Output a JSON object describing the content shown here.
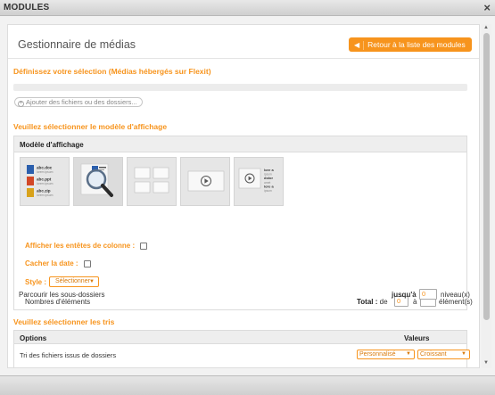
{
  "window": {
    "title": "MODULES",
    "close_glyph": "×"
  },
  "header": {
    "title": "Gestionnaire de médias",
    "back_button": "Retour à la liste des modules"
  },
  "selection": {
    "title": "Définissez votre sélection (Médias hébergés sur Flexit)",
    "add_button": "Ajouter des fichiers ou des dossiers..."
  },
  "display": {
    "title": "Veuillez sélectionner le modèle d'affichage",
    "panel_title": "Modèle d'affichage",
    "list_items": [
      {
        "name": "abc.doc",
        "sub": "lorem ipsum"
      },
      {
        "name": "abc.ppt",
        "sub": "lorem ipsum"
      },
      {
        "name": "abc.zip",
        "sub": "lorem ipsum"
      }
    ],
    "list_item_colors": [
      "#2b5fad",
      "#d24726",
      "#d8a21b"
    ],
    "side_text": [
      "lore a",
      "ipsum",
      "dolor",
      "amet",
      "lore a",
      "ipsum"
    ],
    "show_headers_label": "Afficher les entêtes de colonne :",
    "hide_date_label": "Cacher la date :",
    "style_label": "Style :",
    "style_value": "Sélectionner",
    "count_label": "Nombres d'éléments",
    "total_label": "Total :",
    "total_from": "de",
    "total_from_value": "0",
    "total_to": "à",
    "total_to_value": "",
    "total_unit": "élément(s)",
    "subfolders_label": "Parcourir les sous-dossiers",
    "subfolders_until": "jusqu'à",
    "subfolders_value": "0",
    "subfolders_unit": "niveau(x)"
  },
  "sorting": {
    "title": "Veuillez sélectionner les tris",
    "col_options": "Options",
    "col_values": "Valeurs",
    "row_label": "Tri des fichiers issus de dossiers",
    "select1": "Personnalisé",
    "select2": "Croissant"
  },
  "colors": {
    "accent": "#f7941d",
    "panel": "#eeeeee"
  }
}
